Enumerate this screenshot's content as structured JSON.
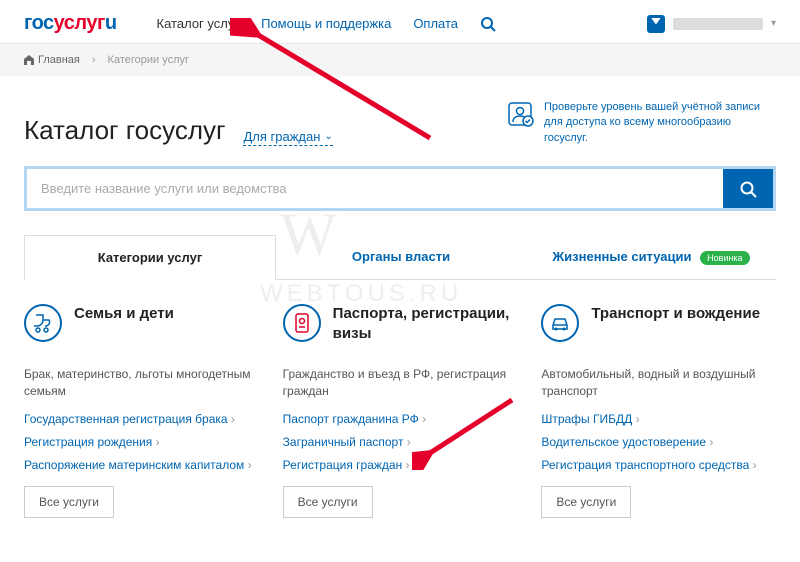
{
  "header": {
    "logo": {
      "p1": "гос",
      "p2": "услуг",
      "p3": "u"
    },
    "nav": [
      {
        "label": "Каталог услуг",
        "active": true
      },
      {
        "label": "Помощь и поддержка",
        "active": false
      },
      {
        "label": "Оплата",
        "active": false
      }
    ]
  },
  "breadcrumb": {
    "home": "Главная",
    "current": "Категории услуг"
  },
  "page": {
    "title": "Каталог госуслуг",
    "filter": "Для граждан",
    "verify_text": "Проверьте уровень вашей учётной записи для доступа ко всему многообразию госуслуг."
  },
  "search": {
    "placeholder": "Введите название услуги или ведомства"
  },
  "tabs": [
    {
      "label": "Категории услуг",
      "active": true,
      "badge": null
    },
    {
      "label": "Органы власти",
      "active": false,
      "badge": null
    },
    {
      "label": "Жизненные ситуации",
      "active": false,
      "badge": "Новинка"
    }
  ],
  "categories": [
    {
      "icon": "stroller",
      "title": "Семья и дети",
      "desc": "Брак, материнство, льготы многодетным семьям",
      "links": [
        "Государственная регистрация брака",
        "Регистрация рождения",
        "Распоряжение материнским капиталом"
      ],
      "all": "Все услуги"
    },
    {
      "icon": "passport",
      "title": "Паспорта, регистрации, визы",
      "desc": "Гражданство и въезд в РФ, регистрация граждан",
      "links": [
        "Паспорт гражданина РФ",
        "Заграничный паспорт",
        "Регистрация граждан"
      ],
      "all": "Все услуги"
    },
    {
      "icon": "car",
      "title": "Транспорт и вождение",
      "desc": "Автомобильный, водный и воздушный транспорт",
      "links": [
        "Штрафы ГИБДД",
        "Водительское удостоверение",
        "Регистрация транспортного средства"
      ],
      "all": "Все услуги"
    }
  ],
  "watermark": {
    "big": "W",
    "text": "WEBTOUS.RU"
  }
}
